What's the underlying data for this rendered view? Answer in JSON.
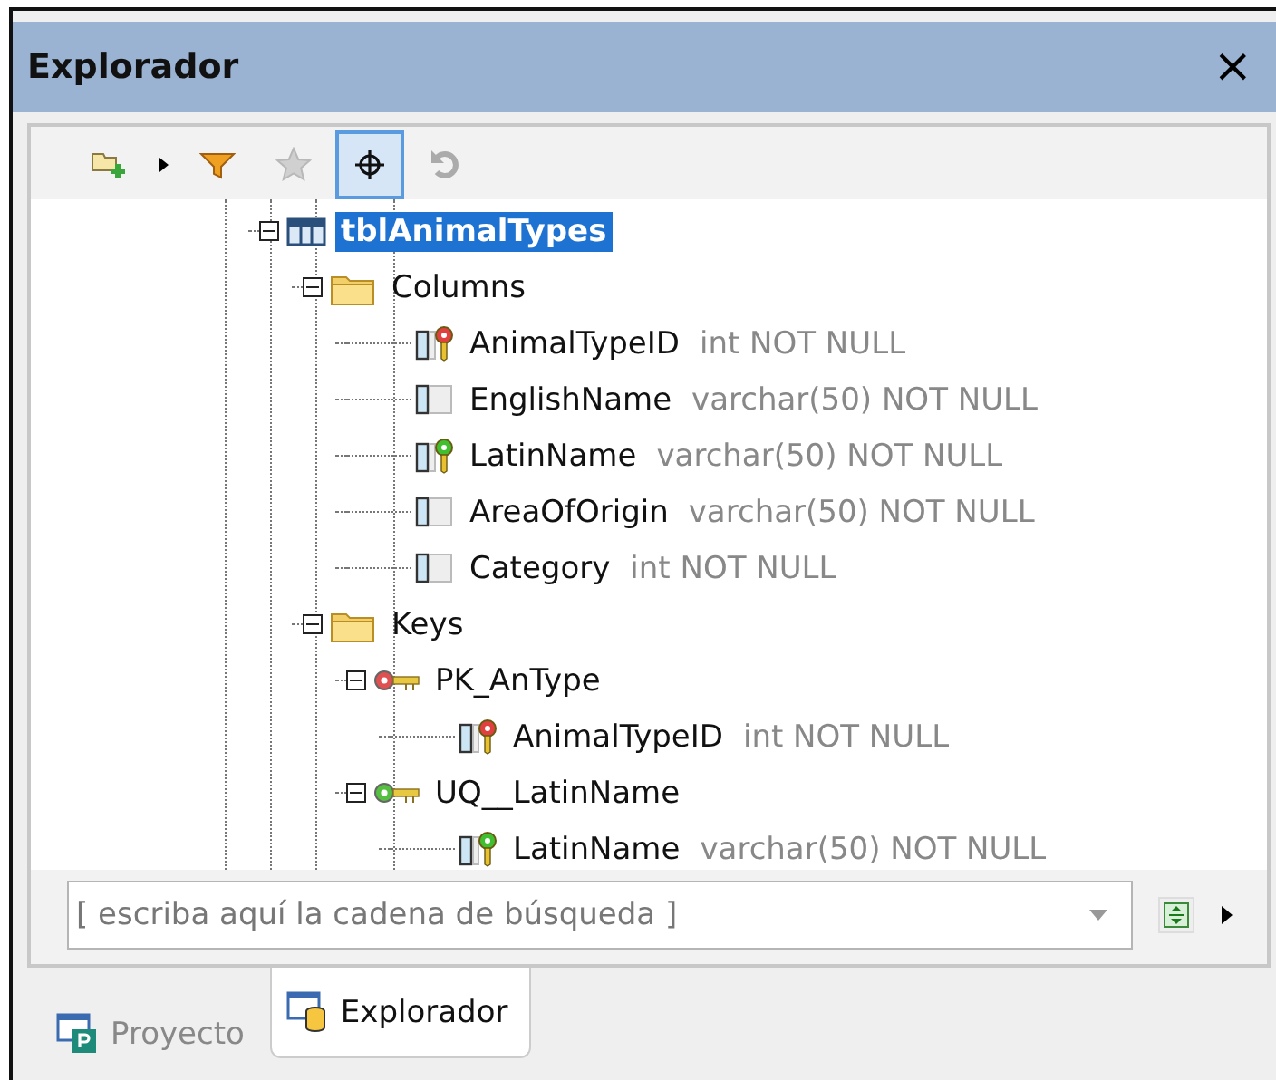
{
  "window": {
    "title": "Explorador",
    "close": "×"
  },
  "toolbar": [
    {
      "kind": "add-folder",
      "disabled": false,
      "on": false
    },
    {
      "kind": "caret",
      "disabled": false,
      "on": false
    },
    {
      "kind": "filter",
      "disabled": false,
      "on": false
    },
    {
      "kind": "star",
      "disabled": true,
      "on": false
    },
    {
      "kind": "locate",
      "disabled": false,
      "on": true
    },
    {
      "kind": "refresh",
      "disabled": true,
      "on": false
    }
  ],
  "tree": [
    {
      "kind": "table",
      "name": "tblAnimalTypes",
      "selected": true,
      "expanded": true,
      "children": [
        {
          "kind": "folder",
          "name": "Columns",
          "selected": false,
          "expanded": true,
          "children": [
            {
              "kind": "primary-key-column",
              "name": "AnimalTypeID",
              "type": "int NOT NULL",
              "selected": false
            },
            {
              "kind": "column",
              "name": "EnglishName",
              "type": "varchar(50) NOT NULL",
              "selected": false
            },
            {
              "kind": "unique-key-column",
              "name": "LatinName",
              "type": "varchar(50) NOT NULL",
              "selected": false
            },
            {
              "kind": "column",
              "name": "AreaOfOrigin",
              "type": "varchar(50) NOT NULL",
              "selected": false
            },
            {
              "kind": "column",
              "name": "Category",
              "type": "int NOT NULL",
              "selected": false
            }
          ]
        },
        {
          "kind": "folder",
          "name": "Keys",
          "selected": false,
          "expanded": true,
          "children": [
            {
              "kind": "primary-key",
              "name": "PK_AnType",
              "selected": false,
              "expanded": true,
              "children": [
                {
                  "kind": "primary-key-column",
                  "name": "AnimalTypeID",
                  "type": "int NOT NULL",
                  "selected": false
                }
              ]
            },
            {
              "kind": "unique-key",
              "name": "UQ__LatinName",
              "selected": false,
              "expanded": true,
              "children": [
                {
                  "kind": "unique-key-column",
                  "name": "LatinName",
                  "type": "varchar(50) NOT NULL",
                  "selected": false
                }
              ]
            }
          ]
        }
      ]
    }
  ],
  "search": {
    "placeholder": "[ escriba aquí la cadena de búsqueda ]"
  },
  "tabs": [
    {
      "label": "Proyecto",
      "kind": "project",
      "selected": false
    },
    {
      "label": "Explorador",
      "kind": "explorer",
      "selected": true
    }
  ]
}
